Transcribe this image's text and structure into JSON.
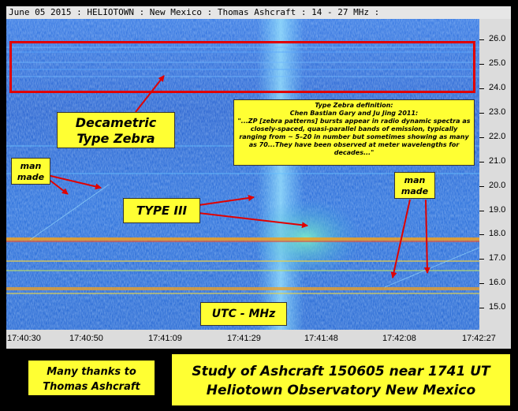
{
  "header": {
    "text": "June 05 2015  :  HELIOTOWN  :  New Mexico  :  Thomas Ashcraft  :  14 - 27 MHz  :"
  },
  "axes": {
    "y_labels": [
      "26.0",
      "25.0",
      "24.0",
      "23.0",
      "22.0",
      "21.0",
      "20.0",
      "19.0",
      "18.0",
      "17.0",
      "16.0",
      "15.0"
    ],
    "x_labels": [
      "17:40:30",
      "17:40:50",
      "17:41:09",
      "17:41:29",
      "17:41:48",
      "17:42:08",
      "17:42:27"
    ]
  },
  "annotations": {
    "decametric": [
      "Decametric",
      "Type Zebra"
    ],
    "definition": {
      "title": "Type Zebra definition:",
      "source": "Chen Bastian Gary and Ju Jing 2011:",
      "quote": "\"...ZP [zebra patterns] bursts appear in radio dynamic spectra as closely-spaced, quasi-parallel bands of emission, typically ranging from ~ 5–20 in number but sometimes showing as many as 70...They have been observed at meter wavelengths for decades...\""
    },
    "type_iii": "TYPE III",
    "utc_mhz": "UTC - MHz",
    "man_made_left": [
      "man",
      "made"
    ],
    "man_made_right": [
      "man",
      "made"
    ]
  },
  "footer": {
    "thanks": [
      "Many thanks to",
      "Thomas Ashcraft"
    ],
    "study": [
      "Study of Ashcraft 150605 near 1741 UT",
      "Heliotown Observatory New Mexico"
    ]
  },
  "colors": {
    "spectrogram_base": "#1d5fd0",
    "highlight_rect": "#e00000",
    "label_bg": "#ffff33",
    "arrow": "#e00000"
  }
}
